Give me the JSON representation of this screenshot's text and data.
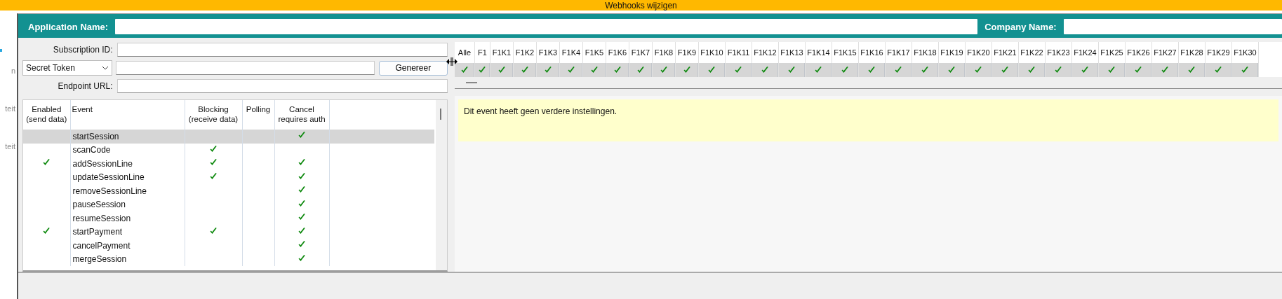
{
  "window": {
    "title": "Webhooks wijzigen"
  },
  "sidebar": {
    "items": [
      "n",
      "teit",
      "teit"
    ]
  },
  "header": {
    "application_name_label": "Application Name:",
    "company_name_label": "Company Name:"
  },
  "form": {
    "subscription_id_label": "Subscription ID:",
    "token_type": "Secret Token",
    "generate_button": "Genereer",
    "endpoint_url_label": "Endpoint URL:"
  },
  "events_table": {
    "columns": [
      "Enabled\n(send data)",
      "Event",
      "Blocking\n(receive data)",
      "Polling",
      "Cancel\nrequires auth"
    ],
    "rows": [
      {
        "event": "startSession",
        "enabled": false,
        "blocking": false,
        "polling": false,
        "cancel_requires_auth": true,
        "selected": true
      },
      {
        "event": "scanCode",
        "enabled": false,
        "blocking": true,
        "polling": false,
        "cancel_requires_auth": false,
        "selected": false
      },
      {
        "event": "addSessionLine",
        "enabled": true,
        "blocking": true,
        "polling": false,
        "cancel_requires_auth": true,
        "selected": false
      },
      {
        "event": "updateSessionLine",
        "enabled": false,
        "blocking": true,
        "polling": false,
        "cancel_requires_auth": true,
        "selected": false
      },
      {
        "event": "removeSessionLine",
        "enabled": false,
        "blocking": false,
        "polling": false,
        "cancel_requires_auth": true,
        "selected": false
      },
      {
        "event": "pauseSession",
        "enabled": false,
        "blocking": false,
        "polling": false,
        "cancel_requires_auth": true,
        "selected": false
      },
      {
        "event": "resumeSession",
        "enabled": false,
        "blocking": false,
        "polling": false,
        "cancel_requires_auth": true,
        "selected": false
      },
      {
        "event": "startPayment",
        "enabled": true,
        "blocking": true,
        "polling": false,
        "cancel_requires_auth": true,
        "selected": false
      },
      {
        "event": "cancelPayment",
        "enabled": false,
        "blocking": false,
        "polling": false,
        "cancel_requires_auth": true,
        "selected": false
      },
      {
        "event": "mergeSession",
        "enabled": false,
        "blocking": false,
        "polling": false,
        "cancel_requires_auth": true,
        "selected": false
      }
    ]
  },
  "key_columns": [
    {
      "label": "Alle",
      "checked": true
    },
    {
      "label": "F1",
      "checked": true
    },
    {
      "label": "F1K1",
      "checked": true
    },
    {
      "label": "F1K2",
      "checked": true
    },
    {
      "label": "F1K3",
      "checked": true
    },
    {
      "label": "F1K4",
      "checked": true
    },
    {
      "label": "F1K5",
      "checked": true
    },
    {
      "label": "F1K6",
      "checked": true
    },
    {
      "label": "F1K7",
      "checked": true
    },
    {
      "label": "F1K8",
      "checked": true
    },
    {
      "label": "F1K9",
      "checked": true
    },
    {
      "label": "F1K10",
      "checked": true
    },
    {
      "label": "F1K11",
      "checked": true
    },
    {
      "label": "F1K12",
      "checked": true
    },
    {
      "label": "F1K13",
      "checked": true
    },
    {
      "label": "F1K14",
      "checked": true
    },
    {
      "label": "F1K15",
      "checked": true
    },
    {
      "label": "F1K16",
      "checked": true
    },
    {
      "label": "F1K17",
      "checked": true
    },
    {
      "label": "F1K18",
      "checked": true
    },
    {
      "label": "F1K19",
      "checked": true
    },
    {
      "label": "F1K20",
      "checked": true
    },
    {
      "label": "F1K21",
      "checked": true
    },
    {
      "label": "F1K22",
      "checked": true
    },
    {
      "label": "F1K23",
      "checked": true
    },
    {
      "label": "F1K24",
      "checked": true
    },
    {
      "label": "F1K25",
      "checked": true
    },
    {
      "label": "F1K26",
      "checked": true
    },
    {
      "label": "F1K27",
      "checked": true
    },
    {
      "label": "F1K28",
      "checked": true
    },
    {
      "label": "F1K29",
      "checked": true
    },
    {
      "label": "F1K30",
      "checked": true
    }
  ],
  "info_message": "Dit event heeft geen verdere instellingen."
}
